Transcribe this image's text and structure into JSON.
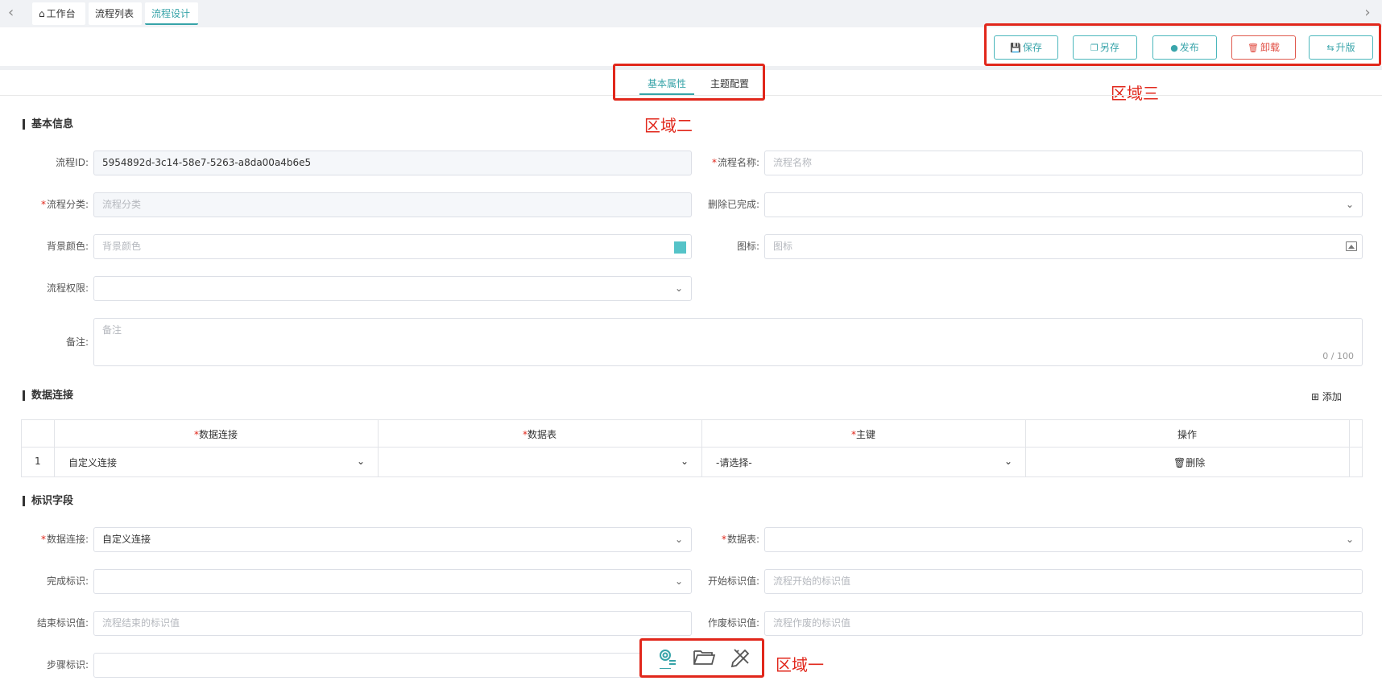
{
  "tabs": {
    "home": "工作台",
    "list": "流程列表",
    "design": "流程设计"
  },
  "toolbar": {
    "save": "保存",
    "save_as": "另存",
    "publish": "发布",
    "uninstall": "卸载",
    "upgrade": "升版"
  },
  "annotations": {
    "zone1": "区域一",
    "zone2": "区域二",
    "zone3": "区域三"
  },
  "prop_tabs": {
    "basic": "基本属性",
    "theme": "主题配置"
  },
  "basic_info": {
    "title": "基本信息",
    "flow_id_label": "流程ID:",
    "flow_id_value": "5954892d-3c14-58e7-5263-a8da00a4b6e5",
    "flow_name_label": "流程名称:",
    "flow_name_placeholder": "流程名称",
    "category_label": "流程分类:",
    "category_placeholder": "流程分类",
    "delete_done_label": "删除已完成:",
    "bg_color_label": "背景颜色:",
    "bg_color_placeholder": "背景颜色",
    "bg_color_value": "#55c3c8",
    "icon_label": "图标:",
    "icon_placeholder": "图标",
    "permission_label": "流程权限:",
    "remark_label": "备注:",
    "remark_placeholder": "备注",
    "remark_counter": "0 / 100"
  },
  "data_conn": {
    "title": "数据连接",
    "add_label": "添加",
    "columns": [
      "数据连接",
      "数据表",
      "主键",
      "操作"
    ],
    "rows": [
      {
        "index": "1",
        "connection": "自定义连接",
        "table": "",
        "primary_key": "-请选择-",
        "action": "删除"
      }
    ]
  },
  "id_fields": {
    "title": "标识字段",
    "conn_label": "数据连接:",
    "conn_value": "自定义连接",
    "table_label": "数据表:",
    "done_label": "完成标识:",
    "start_label": "开始标识值:",
    "start_placeholder": "流程开始的标识值",
    "end_label": "结束标识值:",
    "end_placeholder": "流程结束的标识值",
    "void_label": "作废标识值:",
    "void_placeholder": "流程作废的标识值",
    "step_label": "步骤标识:"
  },
  "colors": {
    "accent": "#36a3a8",
    "danger": "#e04a3f",
    "annotation": "#e1271b"
  }
}
